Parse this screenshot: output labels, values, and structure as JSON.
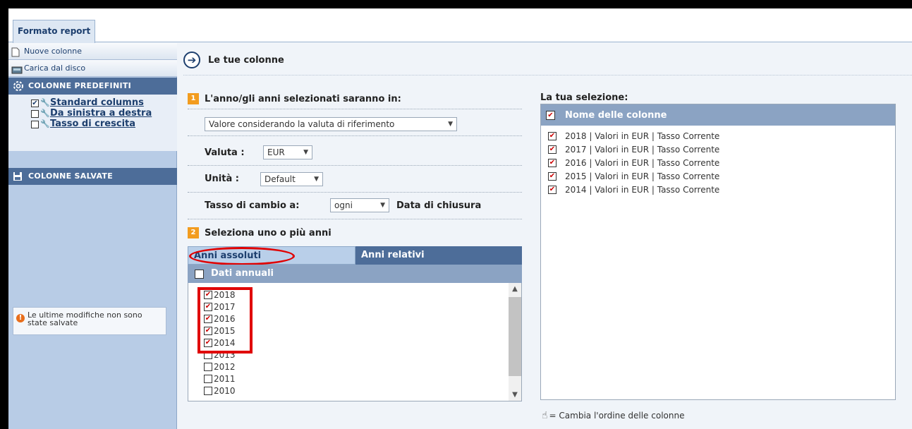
{
  "tab": {
    "label": "Formato report"
  },
  "sidebar": {
    "new_columns": "Nuove colonne",
    "load_disk": "Carica dal disco",
    "predefined_header": "COLONNE PREDEFINITI",
    "predefined_items": [
      {
        "label": "Standard columns",
        "checked": true
      },
      {
        "label": "Da sinistra a destra",
        "checked": false
      },
      {
        "label": "Tasso di crescita",
        "checked": false
      }
    ],
    "saved_header": "COLONNE SALVATE",
    "note": "Le ultime modifiche non sono state salvate"
  },
  "main": {
    "title": "Le tue colonne",
    "step1": {
      "num": "1",
      "label": "L'anno/gli anni selezionati saranno in:"
    },
    "value_select": "Valore considerando la valuta di riferimento",
    "valuta": {
      "label": "Valuta :",
      "value": "EUR"
    },
    "unita": {
      "label": "Unità :",
      "value": "Default"
    },
    "tasso": {
      "label": "Tasso di cambio a:",
      "value": "ogni",
      "suffix": "Data di chiusura"
    },
    "step2": {
      "num": "2",
      "label": "Seleziona uno o più anni"
    },
    "tabs": {
      "absolute": "Anni assoluti",
      "relative": "Anni relativi"
    },
    "annual_header": "Dati annuali",
    "years": [
      {
        "label": "2018",
        "checked": true
      },
      {
        "label": "2017",
        "checked": true
      },
      {
        "label": "2016",
        "checked": true
      },
      {
        "label": "2015",
        "checked": true
      },
      {
        "label": "2014",
        "checked": true
      },
      {
        "label": "2013",
        "checked": false
      },
      {
        "label": "2012",
        "checked": false
      },
      {
        "label": "2011",
        "checked": false
      },
      {
        "label": "2010",
        "checked": false
      }
    ]
  },
  "selection": {
    "title": "La tua selezione:",
    "header": "Nome delle colonne",
    "items": [
      "2018 | Valori in EUR | Tasso Corrente",
      "2017 | Valori in EUR | Tasso Corrente",
      "2016 | Valori in EUR | Tasso Corrente",
      "2015 | Valori in EUR | Tasso Corrente",
      "2014 | Valori in EUR | Tasso Corrente"
    ],
    "reorder_hint": "= Cambia l'ordine delle colonne"
  },
  "colors": {
    "accent": "#4d6d99",
    "header": "#8ba3c3",
    "highlight": "#e00000",
    "step": "#f29c1f"
  }
}
